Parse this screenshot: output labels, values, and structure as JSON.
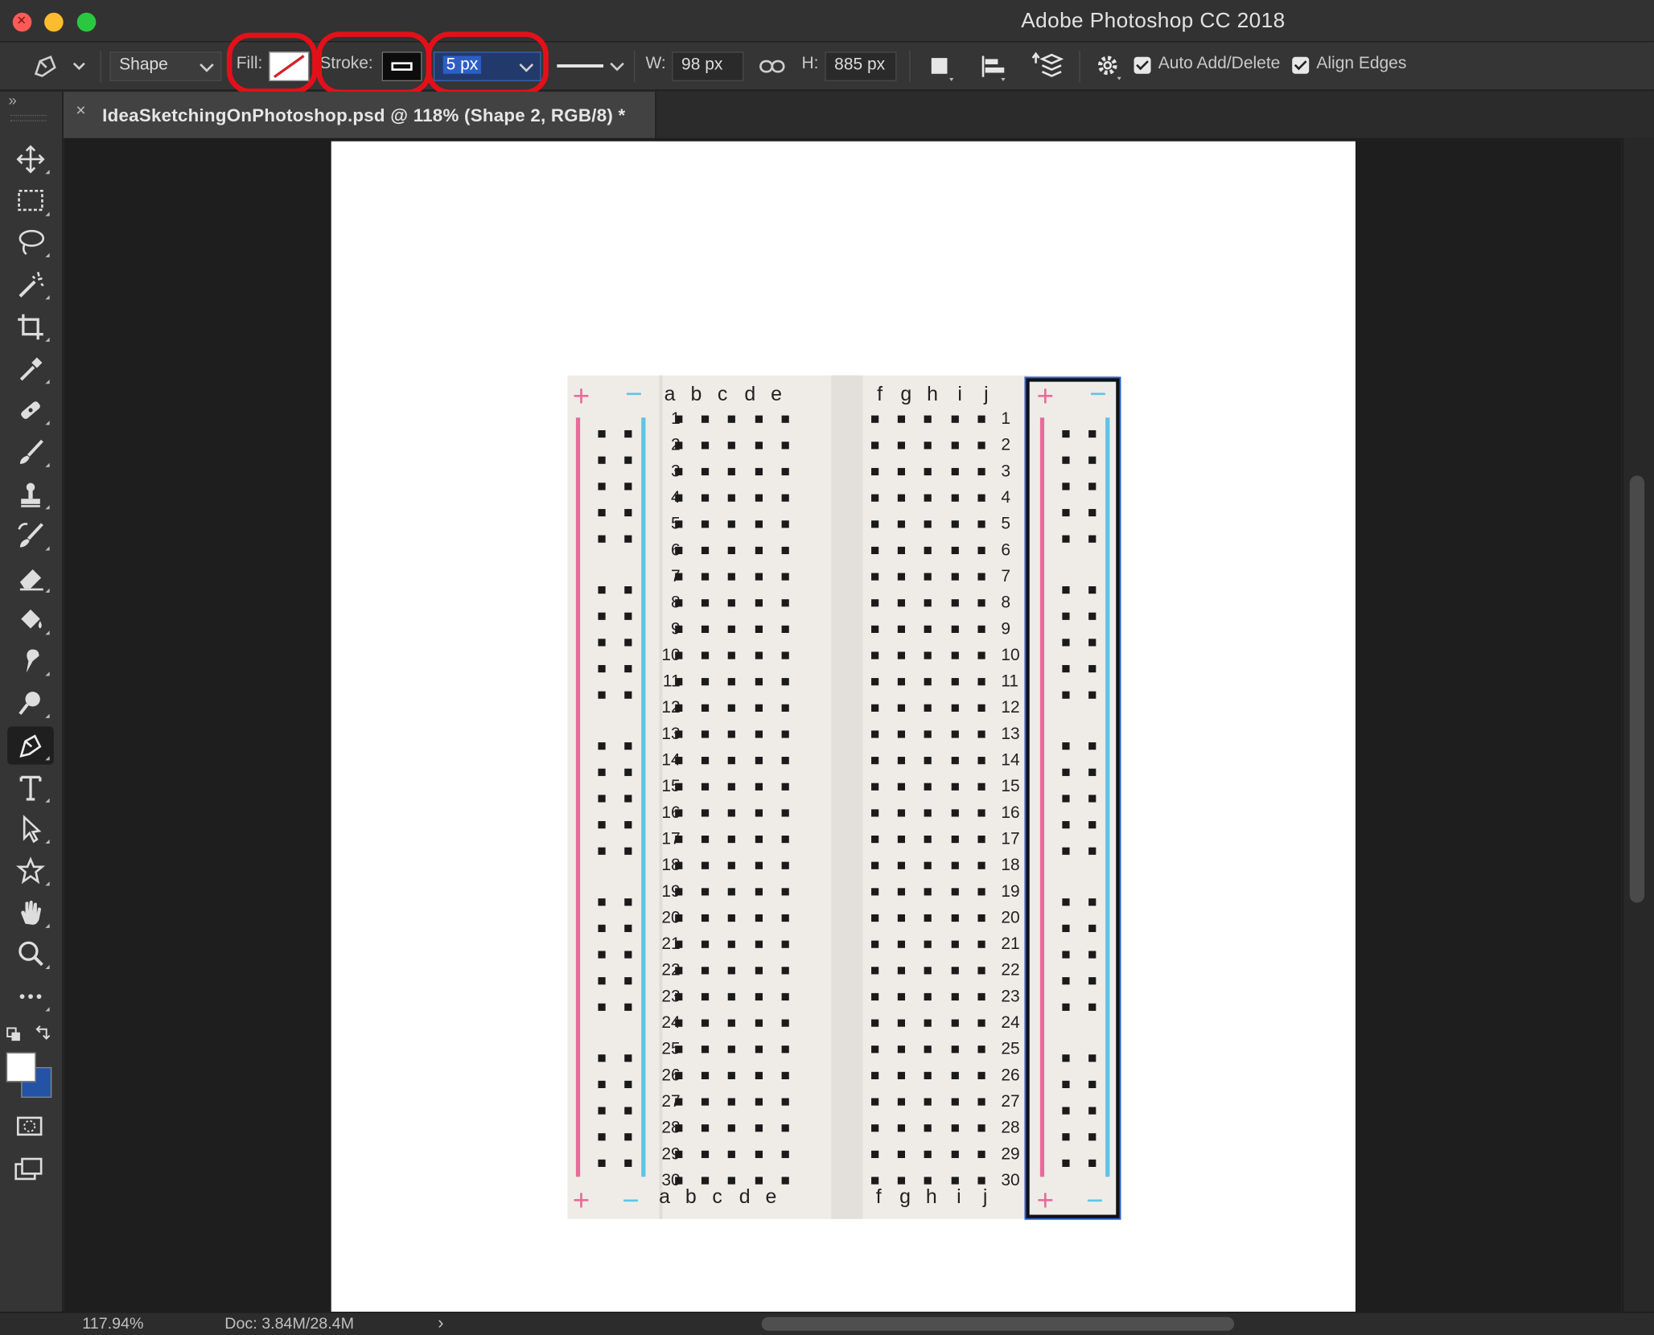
{
  "app": {
    "title": "Adobe Photoshop CC 2018"
  },
  "options": {
    "mode": "Shape",
    "fill_label": "Fill:",
    "stroke_label": "Stroke:",
    "stroke_width": "5 px",
    "w_label": "W:",
    "w_value": "98 px",
    "h_label": "H:",
    "h_value": "885 px",
    "auto_add_delete": "Auto Add/Delete",
    "align_edges": "Align Edges",
    "expand_glyph": "»"
  },
  "tab": {
    "close": "×",
    "title": "IdeaSketchingOnPhotoshop.psd @ 118% (Shape 2, RGB/8) *"
  },
  "tools": [
    "move-icon",
    "marquee-icon",
    "lasso-icon",
    "magic-wand-icon",
    "crop-icon",
    "eyedropper-icon",
    "healing-brush-icon",
    "brush-icon",
    "clone-stamp-icon",
    "history-brush-icon",
    "eraser-icon",
    "paint-bucket-icon",
    "smudge-icon",
    "dodge-icon",
    "pen-icon",
    "type-icon",
    "path-selection-icon",
    "custom-shape-icon",
    "hand-icon",
    "zoom-icon",
    "more-icon"
  ],
  "colors": {
    "foreground": "#ffffff",
    "background": "#2452a4",
    "highlight": "#e3101a",
    "rail_red": "#e96b9a",
    "rail_blue": "#5ec4e6"
  },
  "breadboard": {
    "left_cols": [
      "a",
      "b",
      "c",
      "d",
      "e"
    ],
    "right_cols": [
      "f",
      "g",
      "h",
      "i",
      "j"
    ],
    "rows": [
      "1",
      "2",
      "3",
      "4",
      "5",
      "6",
      "7",
      "8",
      "9",
      "10",
      "11",
      "12",
      "13",
      "14",
      "15",
      "16",
      "17",
      "18",
      "19",
      "20",
      "21",
      "22",
      "23",
      "24",
      "25",
      "26",
      "27",
      "28",
      "29",
      "30"
    ],
    "plus": "+",
    "minus": "−"
  },
  "status": {
    "zoom": "117.94%",
    "doc": "Doc: 3.84M/28.4M",
    "arrow": "›"
  }
}
